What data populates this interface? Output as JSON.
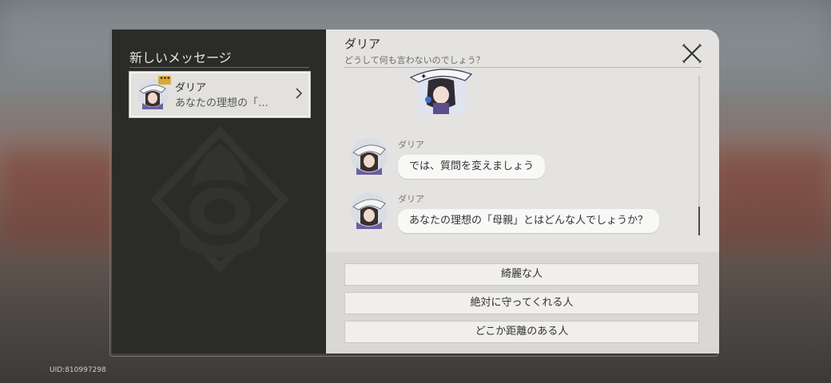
{
  "sidebar": {
    "title": "新しいメッセージ",
    "contacts": [
      {
        "name": "ダリア",
        "preview": "あなたの理想の「…",
        "badge": "•••"
      }
    ]
  },
  "chat": {
    "name": "ダリア",
    "status": "どうして何も言わないのでしょう？",
    "messages": [
      {
        "sender": "ダリア",
        "text": "では、質問を変えましょう"
      },
      {
        "sender": "ダリア",
        "text": "あなたの理想の「母親」とはどんな人でしょうか？"
      }
    ],
    "choices": [
      "綺麗な人",
      "絶対に守ってくれる人",
      "どこか距離のある人"
    ]
  },
  "footer": {
    "uid": "UID:810997298"
  },
  "colors": {
    "accent_badge": "#d8a93a",
    "left_panel": "#2b2b2a",
    "right_panel": "#e4e3e1"
  }
}
